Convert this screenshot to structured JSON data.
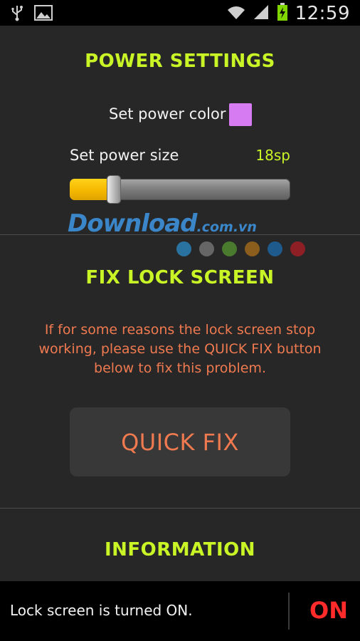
{
  "status_bar": {
    "time": "12:59",
    "icons": [
      "usb-icon",
      "image-icon",
      "wifi-icon",
      "signal-icon",
      "battery-charging-icon"
    ]
  },
  "power_settings": {
    "title": "POWER SETTINGS",
    "color_label": "Set power color",
    "color_value": "#d77bf3",
    "size_label": "Set power size",
    "size_value": "18sp",
    "slider_fraction": 0.18
  },
  "watermark": {
    "main": "Download",
    "sub": ".com.vn"
  },
  "color_dots": [
    "#2a73a0",
    "#666666",
    "#4a7a2e",
    "#8c5e1e",
    "#1f5a8c",
    "#8e1f25"
  ],
  "fix_lock_screen": {
    "title": "FIX LOCK SCREEN",
    "message_lines": [
      "If for some reasons the lock screen stop",
      "working, please use the QUICK FIX button",
      "below to fix this problem."
    ],
    "button_label": "QUICK FIX"
  },
  "information": {
    "title": "INFORMATION"
  },
  "bottom_bar": {
    "status_text": "Lock screen is turned ON.",
    "toggle_label": "ON"
  },
  "colors": {
    "accent_green": "#c9f526",
    "accent_orange": "#f07a50",
    "on_red": "#ff2b2b"
  }
}
